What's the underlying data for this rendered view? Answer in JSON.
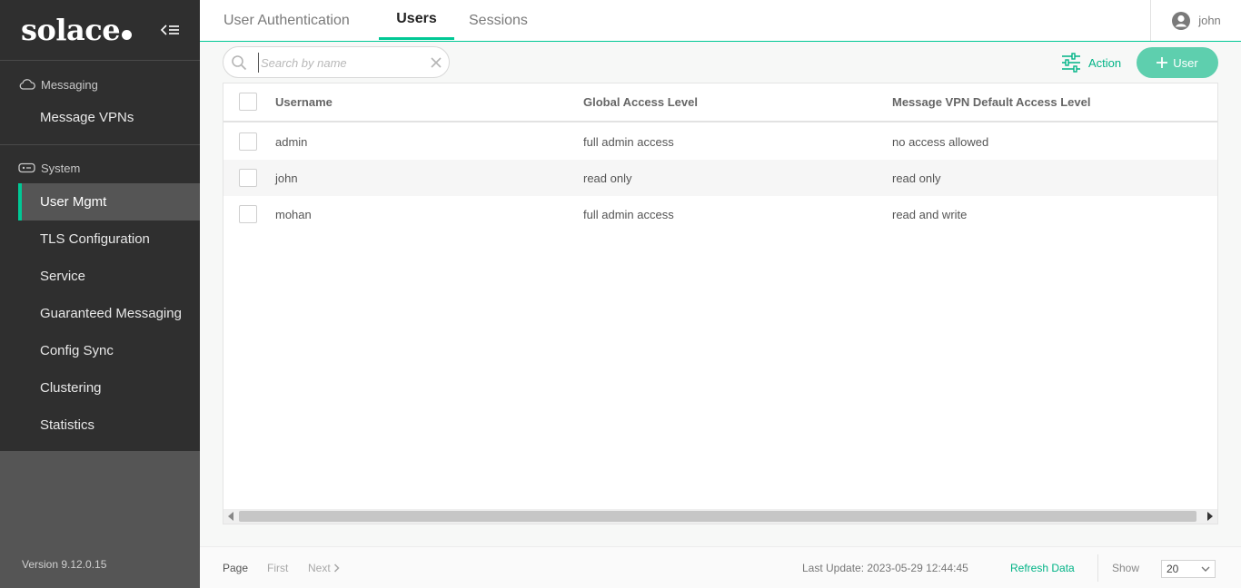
{
  "sidebar": {
    "logo": "solace",
    "sections": [
      {
        "label": "Messaging",
        "items": [
          {
            "label": "Message VPNs"
          }
        ]
      },
      {
        "label": "System",
        "items": [
          {
            "label": "User Mgmt"
          },
          {
            "label": "TLS Configuration"
          },
          {
            "label": "Service"
          },
          {
            "label": "Guaranteed Messaging"
          },
          {
            "label": "Config Sync"
          },
          {
            "label": "Clustering"
          },
          {
            "label": "Statistics"
          }
        ]
      }
    ],
    "active_item": "User Mgmt",
    "version": "Version 9.12.0.15"
  },
  "tabs": [
    {
      "label": "User Authentication"
    },
    {
      "label": "Users"
    },
    {
      "label": "Sessions"
    }
  ],
  "active_tab": "Users",
  "user": {
    "name": "john"
  },
  "toolbar": {
    "search_placeholder": "Search by name",
    "search_value": "",
    "action_label": "Action",
    "add_label": "User"
  },
  "table": {
    "columns": [
      "Username",
      "Global Access Level",
      "Message VPN Default Access Level"
    ],
    "rows": [
      {
        "username": "admin",
        "global": "full admin access",
        "vpn_default": "no access allowed"
      },
      {
        "username": "john",
        "global": "read only",
        "vpn_default": "read only"
      },
      {
        "username": "mohan",
        "global": "full admin access",
        "vpn_default": "read and write"
      }
    ]
  },
  "footer": {
    "page_label": "Page",
    "first_label": "First",
    "next_label": "Next",
    "last_update": "Last Update: 2023-05-29 12:44:45",
    "refresh_label": "Refresh Data",
    "show_label": "Show",
    "show_value": "20"
  },
  "colors": {
    "accent": "#00c895",
    "sidebar_bg": "#2f2f2f",
    "add_button": "#5ecfae"
  }
}
